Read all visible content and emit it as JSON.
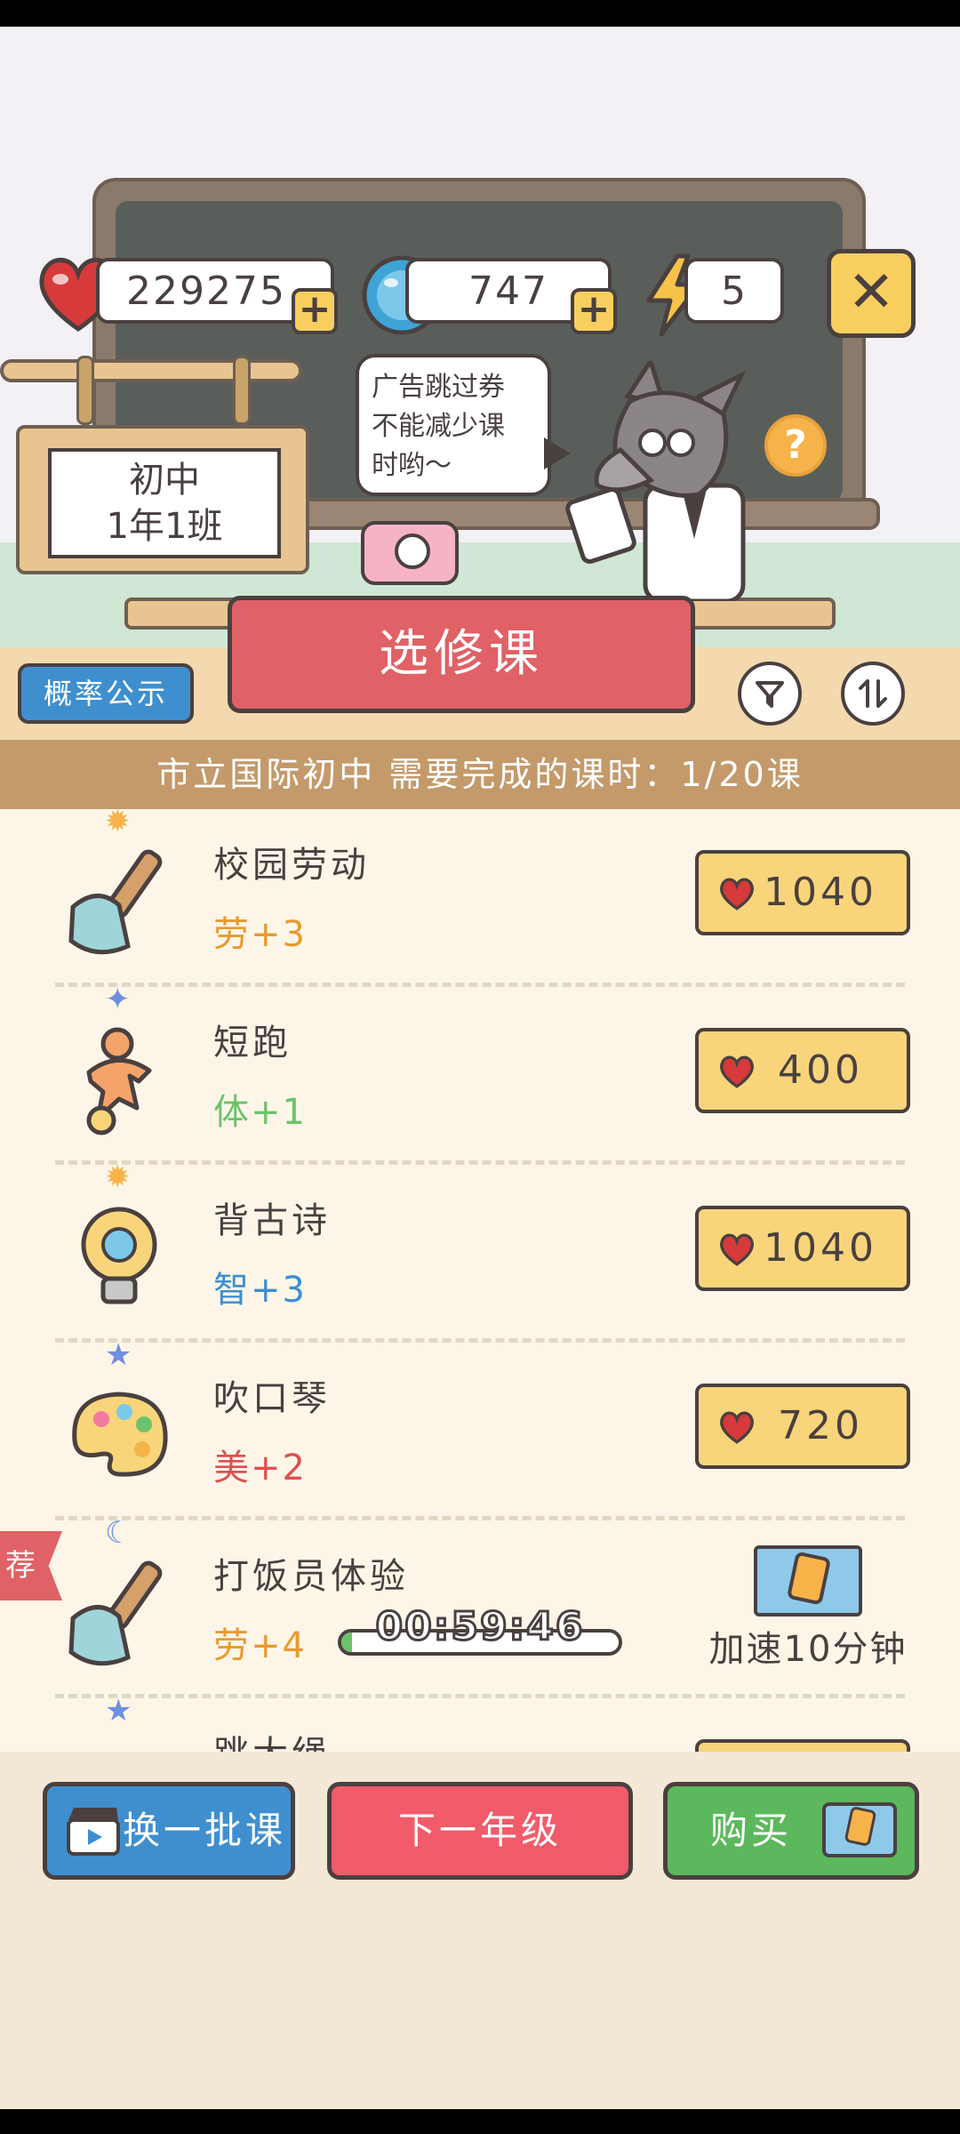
{
  "resources": {
    "hearts": "229275",
    "gems": "747",
    "energy": "5"
  },
  "sign": {
    "line1": "初中",
    "line2": "1年1班"
  },
  "speech_bubble": {
    "line1": "广告跳过券",
    "line2": "不能减少课",
    "line3": "时哟～"
  },
  "header": {
    "probability_label": "概率公示",
    "title": "选修课",
    "filter_icon": "filter-icon",
    "sort_icon": "sort-icon",
    "info": "市立国际初中 需要完成的课时：1/20课"
  },
  "courses": [
    {
      "name": "校园劳动",
      "stat": "劳+3",
      "stat_color": "#e89a30",
      "cost": "1040",
      "badge": "sun",
      "icon": "shovel-icon"
    },
    {
      "name": "短跑",
      "stat": "体+1",
      "stat_color": "#6cc36b",
      "cost": "400",
      "badge": "star",
      "icon": "runner-icon"
    },
    {
      "name": "背古诗",
      "stat": "智+3",
      "stat_color": "#3f8fcf",
      "cost": "1040",
      "badge": "sun",
      "icon": "lightbulb-icon"
    },
    {
      "name": "吹口琴",
      "stat": "美+2",
      "stat_color": "#e05050",
      "cost": "720",
      "badge": "star",
      "icon": "palette-icon"
    },
    {
      "name": "打饭员体验",
      "stat": "劳+4",
      "stat_color": "#e89a30",
      "badge": "moon",
      "icon": "shovel-icon",
      "recommended_label": "荐",
      "timer": "00:59:46",
      "progress": 0.04,
      "speed_label": "加速10分钟"
    },
    {
      "name": "跳大绳",
      "badge": "star",
      "icon": "runner-icon"
    }
  ],
  "buttons": {
    "refresh": "换一批课",
    "next_grade": "下一年级",
    "buy": "购买"
  },
  "colors": {
    "red": "#e06166",
    "blue": "#3f8fcf",
    "green": "#5cb85c",
    "yellow": "#f8d57a",
    "brown": "#c49a6b"
  }
}
